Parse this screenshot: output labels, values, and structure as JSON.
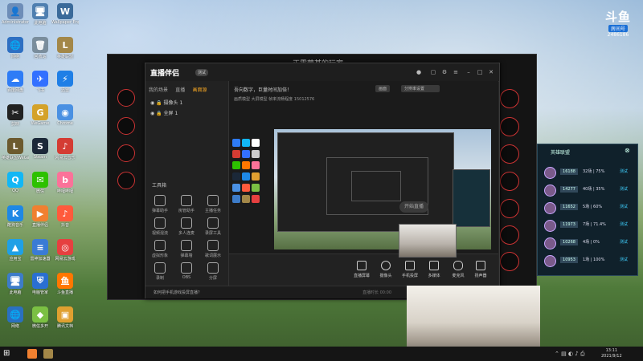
{
  "desktop": {
    "icons": [
      {
        "label": "Administrator",
        "glyph": "👤",
        "color": "#6d8db8"
      },
      {
        "label": "此电脑",
        "glyph": "🖥",
        "color": "#4f7fb0"
      },
      {
        "label": "Wallpaper Engine",
        "glyph": "W",
        "color": "#3a6a9a"
      },
      {
        "label": "网络",
        "glyph": "🌐",
        "color": "#2d6fc2"
      },
      {
        "label": "回收站",
        "glyph": "🗑",
        "color": "#7a8d9c"
      },
      {
        "label": "英雄联盟",
        "glyph": "L",
        "color": "#a38748"
      },
      {
        "label": "百度网盘",
        "glyph": "☁",
        "color": "#2e7cf6"
      },
      {
        "label": "飞书",
        "glyph": "✈",
        "color": "#3370ff"
      },
      {
        "label": "迅雷",
        "glyph": "⚡",
        "color": "#1f7fe6"
      },
      {
        "label": "剪映",
        "glyph": "✂",
        "color": "#222222"
      },
      {
        "label": "WeGame",
        "glyph": "G",
        "color": "#d4a22a"
      },
      {
        "label": "Chrome",
        "glyph": "◉",
        "color": "#4a90e2"
      },
      {
        "label": "英雄联盟WeGame版",
        "glyph": "L",
        "color": "#6c5a2e"
      },
      {
        "label": "Steam",
        "glyph": "S",
        "color": "#1b2838"
      },
      {
        "label": "网易云音乐",
        "glyph": "♪",
        "color": "#d43c33"
      },
      {
        "label": "QQ",
        "glyph": "Q",
        "color": "#12b7f5"
      },
      {
        "label": "微信",
        "glyph": "✉",
        "color": "#2dc100"
      },
      {
        "label": "哔哩哔哩",
        "glyph": "b",
        "color": "#fb7299"
      },
      {
        "label": "酷狗音乐",
        "glyph": "K",
        "color": "#1e88e5"
      },
      {
        "label": "直播伴侣",
        "glyph": "▶",
        "color": "#f08030"
      },
      {
        "label": "抖音",
        "glyph": "♪",
        "color": "#ff5a3c"
      },
      {
        "label": "应用宝",
        "glyph": "▲",
        "color": "#1fa0e6"
      },
      {
        "label": "雷神加速器",
        "glyph": "≡",
        "color": "#3a7bd5"
      },
      {
        "label": "网易云游戏",
        "glyph": "◎",
        "color": "#e64040"
      },
      {
        "label": "此电脑",
        "glyph": "🖥",
        "color": "#3d7cc9"
      },
      {
        "label": "电脑管家",
        "glyph": "⛨",
        "color": "#2a6fd1"
      },
      {
        "label": "斗鱼直播",
        "glyph": "鱼",
        "color": "#ff7700"
      },
      {
        "label": "网络",
        "glyph": "🌐",
        "color": "#2a70c0"
      },
      {
        "label": "微信多开",
        "glyph": "◆",
        "color": "#7bc043"
      },
      {
        "label": "腾讯文档",
        "glyph": "▣",
        "color": "#e0a030"
      }
    ]
  },
  "bg_window": {
    "title": "正露营某的玩家"
  },
  "main_window": {
    "logo": "直播伴侣",
    "version": "测试",
    "tabs": [
      "我的场景",
      "直播",
      "画面源"
    ],
    "active_tab": 2,
    "sources": [
      "摄像头 1",
      "全屏 1"
    ],
    "tools_label": "工具箱",
    "tools": [
      "弹幕助手",
      "房管助手",
      "主播任务",
      "视频混流",
      "多人连麦",
      "录屏工具",
      "虚拟形象",
      "弹幕墙",
      "歌词展示",
      "录制",
      "OBS",
      "分屏"
    ],
    "preview_header": "吾向数字，巨量时间加倍！",
    "preview_chip1": "画面",
    "preview_chip2": "分辨率设置",
    "preview_sub": "画质模型  大屏模型   帧率流畅程度  15012576",
    "bottom_buttons": [
      "直播屏幕",
      "摄像头",
      "手机投屏",
      "多媒体",
      "麦克风",
      "扬声器"
    ],
    "start_button": "开始直播",
    "hint": "如何把手机游戏投屏直播？",
    "status": "直播时长  00:00"
  },
  "side_panel": {
    "title": "英雄联盟",
    "rows": [
      {
        "n": "16188",
        "s": "32场 | 75%",
        "l": "测试"
      },
      {
        "n": "14277",
        "s": "40场 | 35%",
        "l": "测试"
      },
      {
        "n": "11652",
        "s": "5场 | 60%",
        "l": "测试"
      },
      {
        "n": "11973",
        "s": "7场 | 71.4%",
        "l": "测试"
      },
      {
        "n": "10268",
        "s": "4场 | 0%",
        "l": "测试"
      },
      {
        "n": "10953",
        "s": "1场 | 100%",
        "l": "测试"
      }
    ]
  },
  "watermark": {
    "logo": "斗鱼",
    "badge": "房间号",
    "number": "2486186"
  },
  "taskbar": {
    "time": "13:11",
    "date": "2021/9/12"
  }
}
